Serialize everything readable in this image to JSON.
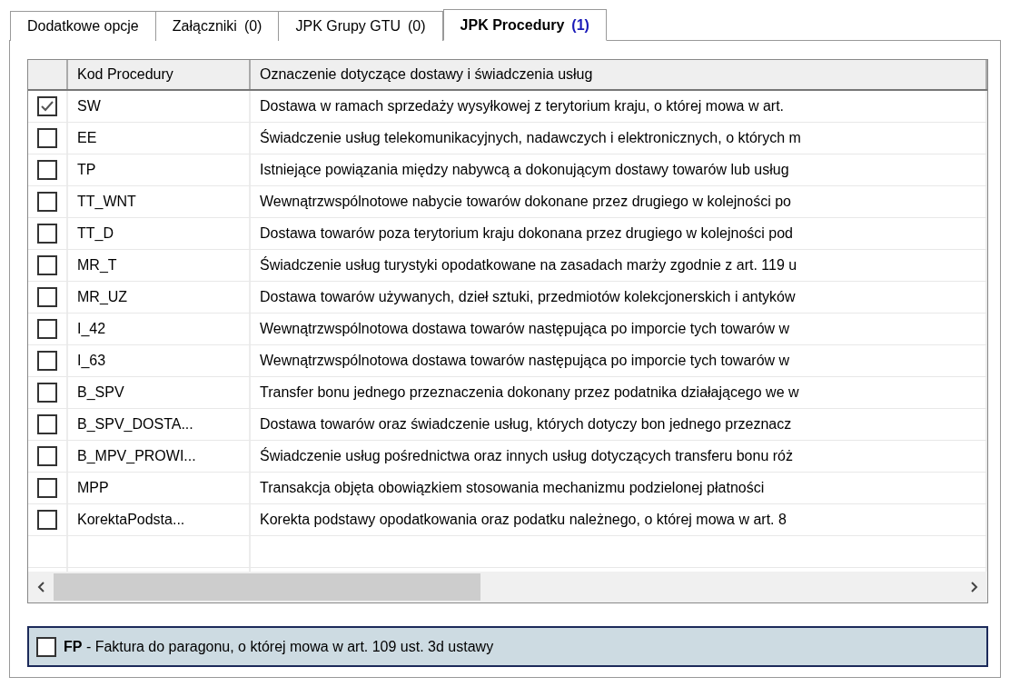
{
  "tabs": [
    {
      "label": "Dodatkowe opcje",
      "selected": false
    },
    {
      "label": "Załączniki",
      "count": "(0)",
      "selected": false
    },
    {
      "label": "JPK Grupy GTU",
      "count": "(0)",
      "selected": false
    },
    {
      "label": "JPK Procedury",
      "count": "(1)",
      "selected": true
    }
  ],
  "table": {
    "columns": [
      "Kod Procedury",
      "Oznaczenie dotyczące dostawy i świadczenia usług"
    ],
    "rows": [
      {
        "code": "SW",
        "description": "Dostawa w ramach sprzedaży wysyłkowej z terytorium kraju, o której mowa w art.",
        "checked": true
      },
      {
        "code": "EE",
        "description": "Świadczenie usług telekomunikacyjnych, nadawczych i elektronicznych, o których m",
        "checked": false
      },
      {
        "code": "TP",
        "description": "Istniejące powiązania między nabywcą a dokonującym dostawy towarów lub usług",
        "checked": false
      },
      {
        "code": "TT_WNT",
        "description": "Wewnątrzwspólnotowe nabycie towarów dokonane przez drugiego w kolejności po",
        "checked": false
      },
      {
        "code": "TT_D",
        "description": "Dostawa towarów poza terytorium kraju dokonana przez drugiego w kolejności pod",
        "checked": false
      },
      {
        "code": "MR_T",
        "description": "Świadczenie usług turystyki opodatkowane na zasadach marży zgodnie z art. 119 u",
        "checked": false
      },
      {
        "code": "MR_UZ",
        "description": "Dostawa towarów używanych, dzieł sztuki, przedmiotów kolekcjonerskich i antyków",
        "checked": false
      },
      {
        "code": "I_42",
        "description": "Wewnątrzwspólnotowa dostawa towarów następująca po imporcie tych towarów w",
        "checked": false
      },
      {
        "code": "I_63",
        "description": "Wewnątrzwspólnotowa dostawa towarów następująca po imporcie tych towarów w",
        "checked": false
      },
      {
        "code": "B_SPV",
        "description": "Transfer bonu jednego przeznaczenia dokonany przez podatnika działającego we w",
        "checked": false
      },
      {
        "code": "B_SPV_DOSTA...",
        "description": "Dostawa towarów oraz świadczenie usług, których dotyczy bon jednego przeznacz",
        "checked": false
      },
      {
        "code": "B_MPV_PROWI...",
        "description": "Świadczenie usług pośrednictwa oraz innych usług dotyczących transferu bonu róż",
        "checked": false
      },
      {
        "code": "MPP",
        "description": "Transakcja objęta obowiązkiem stosowania mechanizmu podzielonej płatności",
        "checked": false
      },
      {
        "code": "KorektaPodsta...",
        "description": "Korekta podstawy opodatkowania oraz podatku należnego, o której mowa w art. 8",
        "checked": false
      }
    ]
  },
  "fp_option": {
    "code": "FP",
    "text": "- Faktura do paragonu, o której mowa w art. 109 ust. 3d ustawy",
    "checked": false
  }
}
